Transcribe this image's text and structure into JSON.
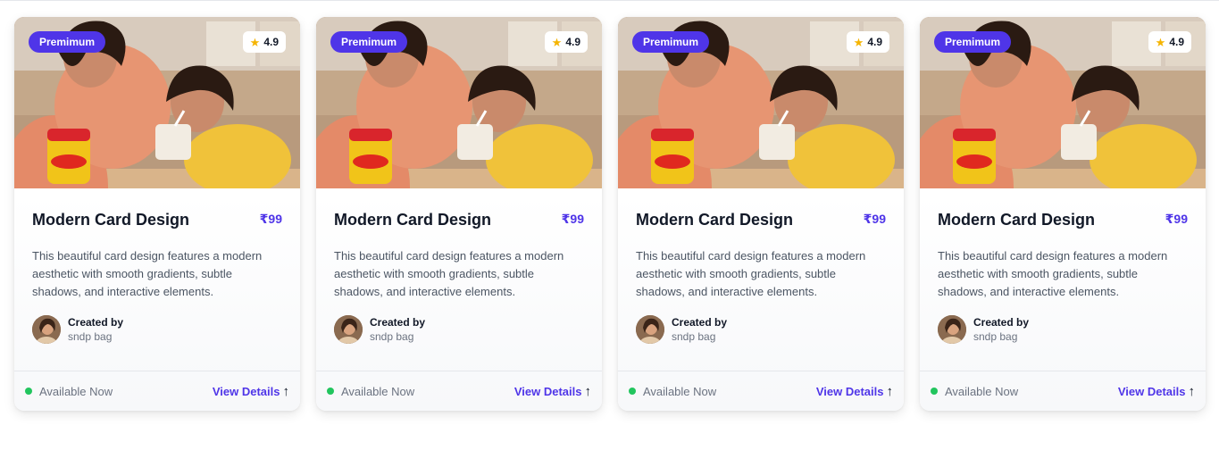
{
  "colors": {
    "accent": "#4f35e8",
    "status_green": "#22c55e",
    "star": "#f5b400"
  },
  "cards": [
    {
      "badge": "Premimum",
      "rating": "4.9",
      "title": "Modern Card Design",
      "price": "₹99",
      "description": "This beautiful card design features a modern aesthetic with smooth gradients, subtle shadows, and interactive elements.",
      "created_by_label": "Created by",
      "creator": "sndp bag",
      "status": "Available Now",
      "details_label": "View Details",
      "image_icon": "photo-mother-child-complan",
      "arrow_icon": "arrow-up-icon"
    },
    {
      "badge": "Premimum",
      "rating": "4.9",
      "title": "Modern Card Design",
      "price": "₹99",
      "description": "This beautiful card design features a modern aesthetic with smooth gradients, subtle shadows, and interactive elements.",
      "created_by_label": "Created by",
      "creator": "sndp bag",
      "status": "Available Now",
      "details_label": "View Details",
      "image_icon": "photo-mother-child-complan",
      "arrow_icon": "arrow-up-icon"
    },
    {
      "badge": "Premimum",
      "rating": "4.9",
      "title": "Modern Card Design",
      "price": "₹99",
      "description": "This beautiful card design features a modern aesthetic with smooth gradients, subtle shadows, and interactive elements.",
      "created_by_label": "Created by",
      "creator": "sndp bag",
      "status": "Available Now",
      "details_label": "View Details",
      "image_icon": "photo-mother-child-complan",
      "arrow_icon": "arrow-up-icon"
    },
    {
      "badge": "Premimum",
      "rating": "4.9",
      "title": "Modern Card Design",
      "price": "₹99",
      "description": "This beautiful card design features a modern aesthetic with smooth gradients, subtle shadows, and interactive elements.",
      "created_by_label": "Created by",
      "creator": "sndp bag",
      "status": "Available Now",
      "details_label": "View Details",
      "image_icon": "photo-mother-child-complan",
      "arrow_icon": "arrow-up-icon"
    }
  ]
}
